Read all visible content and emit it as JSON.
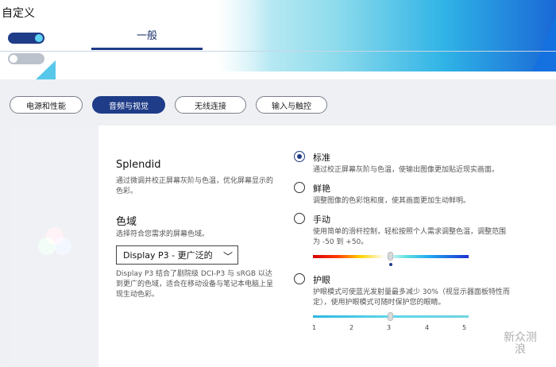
{
  "app": {
    "title": "自定义"
  },
  "header": {
    "active_tab": "一般"
  },
  "pills": [
    {
      "label": "电源和性能",
      "active": false
    },
    {
      "label": "音频与视觉",
      "active": true
    },
    {
      "label": "无线连接",
      "active": false
    },
    {
      "label": "输入与触控",
      "active": false
    }
  ],
  "splendid": {
    "title": "Splendid",
    "desc": "通过微调并校正屏幕灰阶与色温，优化屏幕显示的色彩。"
  },
  "gamut": {
    "title": "色域",
    "desc": "选择符合您需求的屏幕色域。",
    "selected": "Display P3 - 更广泛的",
    "note": "Display P3 结合了剧院级 DCI-P3 与 sRGB 以达到更广的色域，适合在移动设备与笔记本电脑上呈现生动色彩。"
  },
  "modes": [
    {
      "label": "标准",
      "desc": "通过校正屏幕灰阶与色温，使输出图像更加贴近现实画面。",
      "selected": true
    },
    {
      "label": "鲜艳",
      "desc": "调整图像的色彩饱和度，使其画面更加生动鲜明。",
      "selected": false
    },
    {
      "label": "手动",
      "desc": "使用简单的滑杆控制，轻松按照个人需求调整色温，调整范围为 -50 到 +50。",
      "selected": false
    },
    {
      "label": "护眼",
      "desc": "护眼模式可使蓝光发射量最多减少 30%（视显示器面板特性而定），使用护眼模式可随时保护您的眼睛。",
      "selected": false
    }
  ],
  "manual_slider": {
    "min": -50,
    "max": 50,
    "value": 0
  },
  "eye_slider": {
    "ticks": [
      "1",
      "2",
      "3",
      "4",
      "5"
    ],
    "value": 3
  },
  "watermark": {
    "line1": "新",
    "line2": "浪",
    "text": "众测"
  }
}
